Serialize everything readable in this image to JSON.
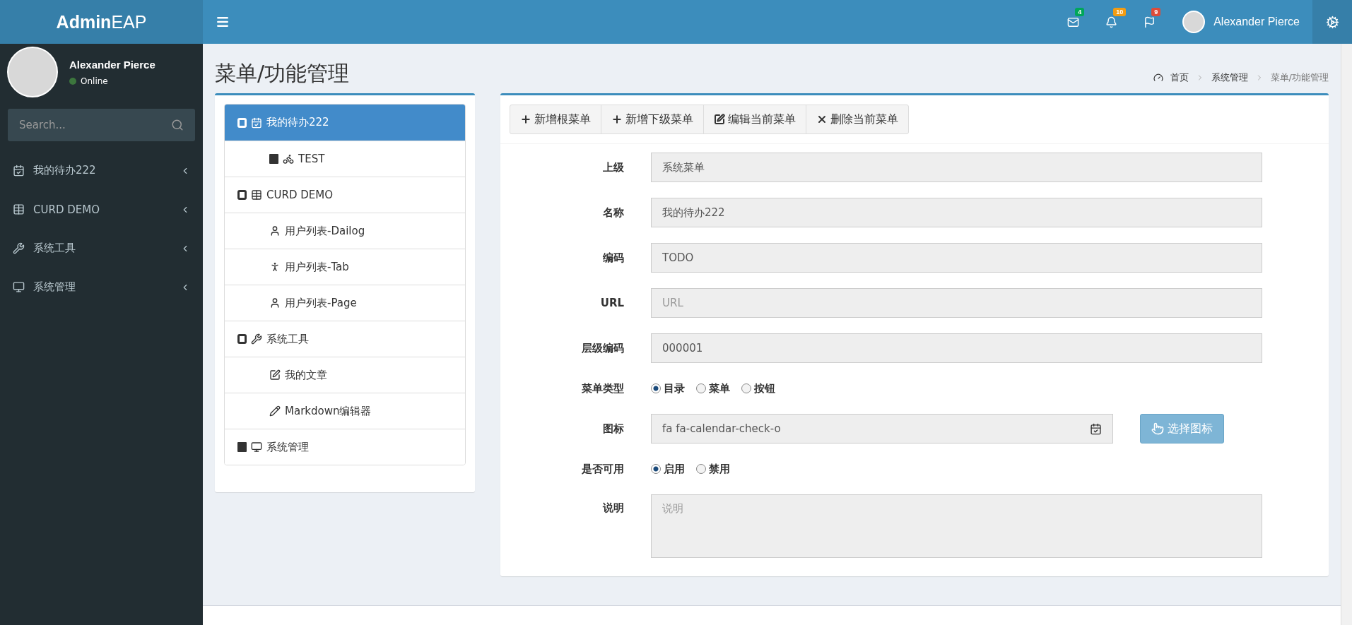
{
  "logo": "**Admin**EAP",
  "header": {
    "notifications": [
      {
        "count": "4",
        "color": "#00a65a"
      },
      {
        "count": "10",
        "color": "#f39c12"
      },
      {
        "count": "9",
        "color": "#dd4b39"
      }
    ],
    "user_name": "Alexander Pierce"
  },
  "sidebar": {
    "user": {
      "name": "Alexander Pierce",
      "status": "Online"
    },
    "search": {
      "placeholder": "Search..."
    },
    "items": [
      {
        "label": "我的待办222"
      },
      {
        "label": "CURD DEMO"
      },
      {
        "label": "系统工具"
      },
      {
        "label": "系统管理"
      }
    ]
  },
  "page": {
    "title": "菜单/功能管理",
    "breadcrumb": [
      "首页",
      "系统管理",
      "菜单/功能管理"
    ]
  },
  "tree": [
    {
      "label": "我的待办222",
      "selected": true,
      "expanded": true,
      "children": [
        {
          "label": "TEST",
          "selected": false,
          "expanded": false
        }
      ]
    },
    {
      "label": "CURD DEMO",
      "selected": false,
      "expanded": true,
      "children": [
        {
          "label": "用户列表-Dailog",
          "selected": false
        },
        {
          "label": "用户列表-Tab",
          "selected": false
        },
        {
          "label": "用户列表-Page",
          "selected": false
        }
      ]
    },
    {
      "label": "系统工具",
      "selected": false,
      "expanded": true,
      "children": [
        {
          "label": "我的文章",
          "selected": false
        },
        {
          "label": "Markdown编辑器",
          "selected": false
        }
      ]
    },
    {
      "label": "系统管理",
      "selected": false,
      "expanded": false
    }
  ],
  "toolbar": [
    "新增根菜单",
    "新增下级菜单",
    "编辑当前菜单",
    "删除当前菜单"
  ],
  "form": [
    {
      "kind": "text",
      "label": "上级",
      "value": "系统菜单"
    },
    {
      "kind": "text",
      "label": "名称",
      "value": "我的待办222"
    },
    {
      "kind": "text",
      "label": "编码",
      "value": "TODO"
    },
    {
      "kind": "text",
      "label": "URL",
      "placeholder": "URL"
    },
    {
      "kind": "text",
      "label": "层级编码",
      "value": "000001"
    },
    {
      "kind": "radio",
      "label": "菜单类型",
      "options": [
        {
          "label": "目录",
          "selected": true
        },
        {
          "label": "菜单",
          "selected": false
        },
        {
          "label": "按钮",
          "selected": false
        }
      ]
    },
    {
      "kind": "icon-picker",
      "label": "图标",
      "value": "fa fa-calendar-check-o",
      "button": "选择图标"
    },
    {
      "kind": "radio",
      "label": "是否可用",
      "options": [
        {
          "label": "启用",
          "selected": true
        },
        {
          "label": "禁用",
          "selected": false
        }
      ]
    },
    {
      "kind": "textarea",
      "label": "说明",
      "placeholder": "说明"
    }
  ]
}
